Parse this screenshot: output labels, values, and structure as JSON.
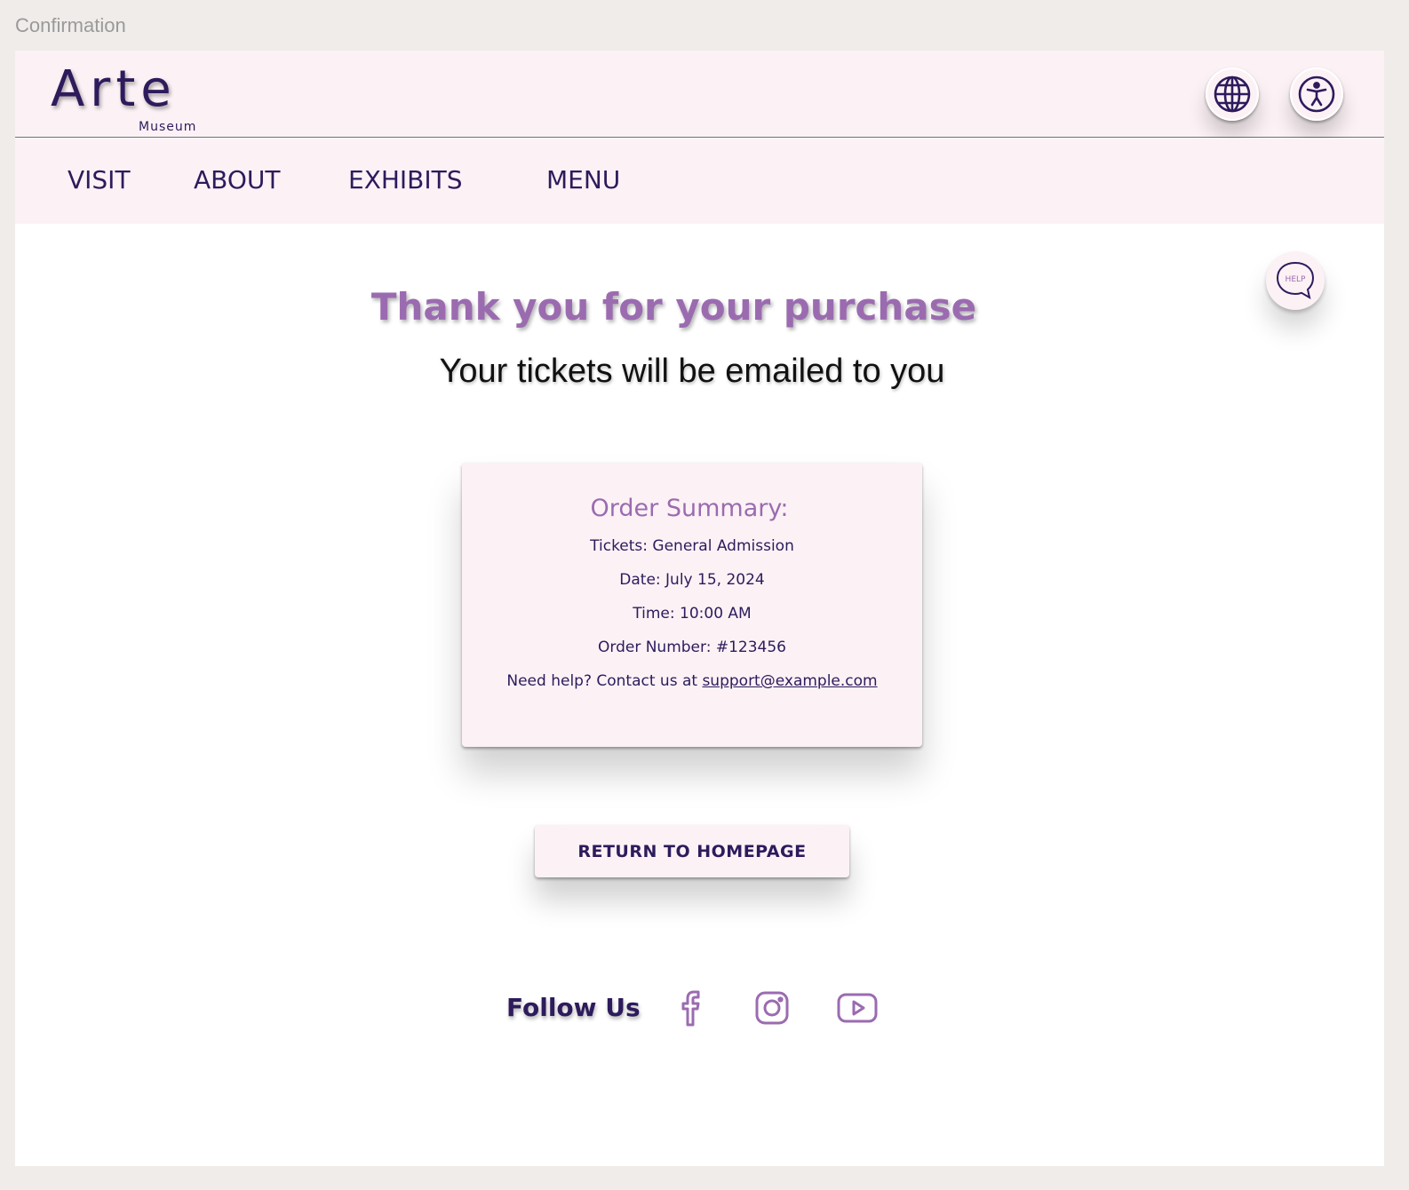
{
  "window": {
    "title": "Confirmation"
  },
  "header": {
    "logo_main": "Arte",
    "logo_sub": "Museum",
    "icons": [
      "globe-icon",
      "accessibility-icon"
    ]
  },
  "nav": {
    "items": [
      "VISIT",
      "ABOUT",
      "EXHIBITS",
      "MENU"
    ]
  },
  "help": {
    "label": "HELP"
  },
  "main": {
    "headline": "Thank you for your purchase",
    "subheadline": "Your tickets will be emailed to you"
  },
  "summary": {
    "title": "Order Summary:",
    "tickets": "Tickets: General Admission",
    "date": "Date: July 15, 2024",
    "time": "Time: 10:00 AM",
    "order_number": "Order Number: #123456",
    "help_text": "Need help? Contact us at",
    "support_email": "support@example.com"
  },
  "actions": {
    "return_label": "RETURN TO HOMEPAGE"
  },
  "footer": {
    "follow_label": "Follow Us",
    "social_icons": [
      "facebook-icon",
      "instagram-icon",
      "youtube-icon"
    ]
  },
  "colors": {
    "primary": "#2d1b5c",
    "accent": "#9b6bb0",
    "surface": "#fcf2f6",
    "backdrop": "#efecea"
  }
}
